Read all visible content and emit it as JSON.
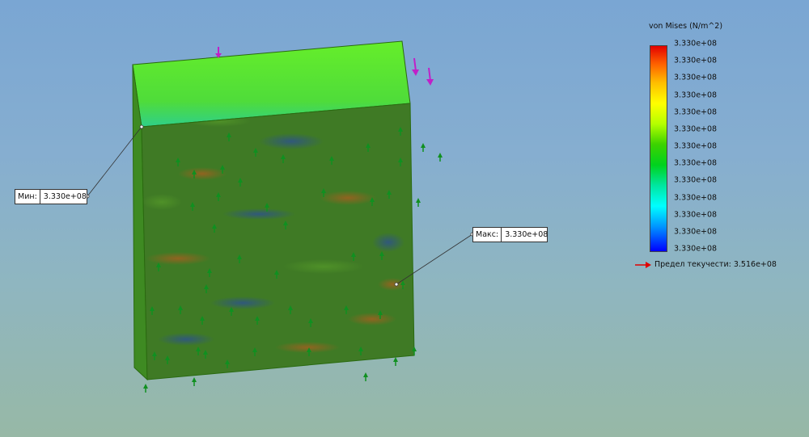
{
  "legend": {
    "title": "von Mises (N/m^2)",
    "ticks": [
      "3.330e+08",
      "3.330e+08",
      "3.330e+08",
      "3.330e+08",
      "3.330e+08",
      "3.330e+08",
      "3.330e+08",
      "3.330e+08",
      "3.330e+08",
      "3.330e+08",
      "3.330e+08",
      "3.330e+08",
      "3.330e+08"
    ],
    "yield_label": "Предел текучести: 3.516e+08",
    "yield_arrow_color": "#e00000"
  },
  "probe_min": {
    "label": "Мин:",
    "value": "3.330e+08"
  },
  "probe_max": {
    "label": "Макс:",
    "value": "3.330e+08"
  },
  "colors": {
    "load_arrow": "#c020c8",
    "fixture_arrow": "#109020",
    "model_top": "#5ee62a",
    "model_front": "#3f7a25"
  },
  "icons": {
    "load": "force-arrow-icon",
    "fixture": "fixture-arrow-icon"
  }
}
